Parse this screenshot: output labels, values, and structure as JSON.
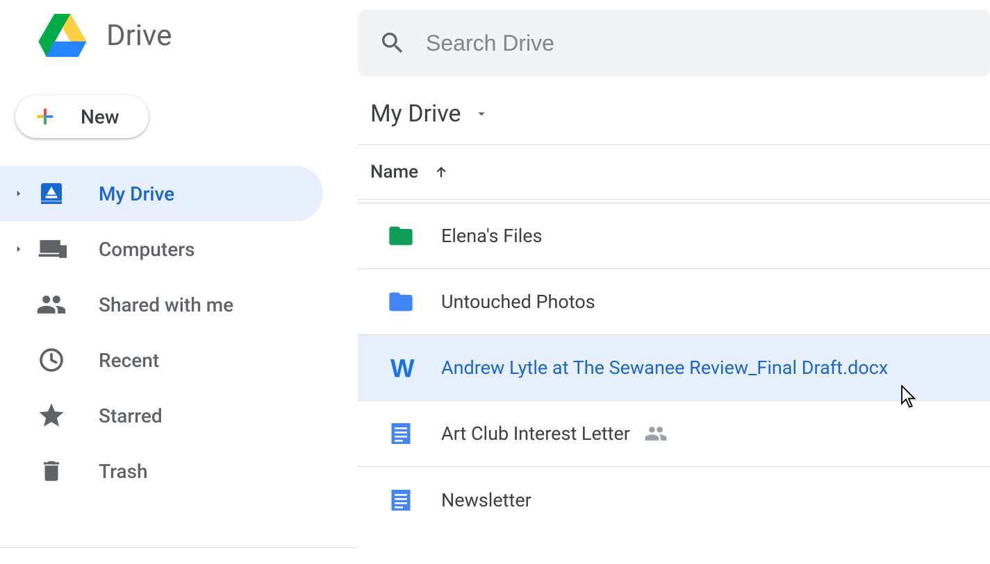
{
  "app": {
    "name": "Drive"
  },
  "search": {
    "placeholder": "Search Drive"
  },
  "new_button": {
    "label": "New"
  },
  "nav": {
    "items": [
      {
        "label": "My Drive",
        "active": true,
        "expandable": true,
        "icon": "drive"
      },
      {
        "label": "Computers",
        "active": false,
        "expandable": true,
        "icon": "computers"
      },
      {
        "label": "Shared with me",
        "active": false,
        "expandable": false,
        "icon": "people"
      },
      {
        "label": "Recent",
        "active": false,
        "expandable": false,
        "icon": "clock"
      },
      {
        "label": "Starred",
        "active": false,
        "expandable": false,
        "icon": "star"
      },
      {
        "label": "Trash",
        "active": false,
        "expandable": false,
        "icon": "trash"
      }
    ]
  },
  "breadcrumb": {
    "title": "My Drive"
  },
  "columns": {
    "name": "Name",
    "sort": "asc"
  },
  "files": [
    {
      "name": "Elena's Files",
      "type": "folder",
      "color": "#0f9d58",
      "selected": false,
      "shared": false
    },
    {
      "name": "Untouched Photos",
      "type": "folder",
      "color": "#4285f4",
      "selected": false,
      "shared": false
    },
    {
      "name": "Andrew Lytle at The Sewanee Review_Final Draft.docx",
      "type": "word",
      "color": "#1a73e8",
      "selected": true,
      "shared": false
    },
    {
      "name": "Art Club Interest Letter",
      "type": "doc",
      "color": "#4285f4",
      "selected": false,
      "shared": true
    },
    {
      "name": "Newsletter",
      "type": "doc",
      "color": "#4285f4",
      "selected": false,
      "shared": false
    }
  ]
}
